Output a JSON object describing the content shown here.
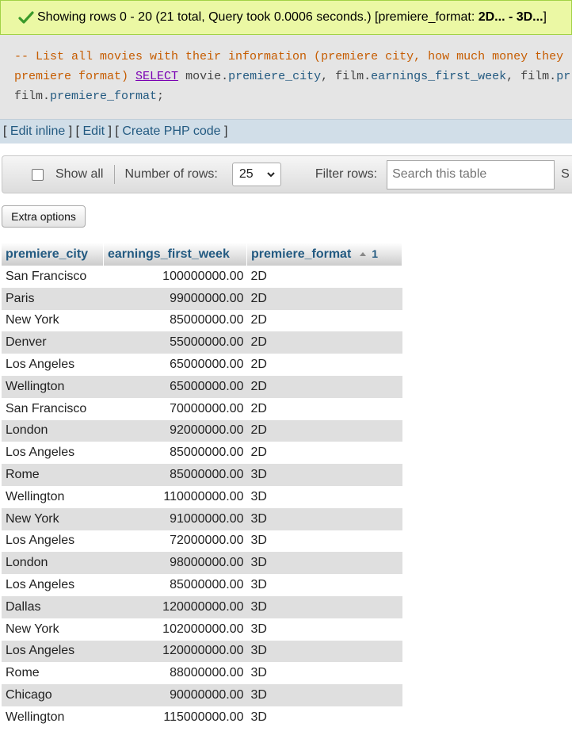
{
  "status": {
    "message": "Showing rows 0 - 20 (21 total, Query took 0.0006 seconds.) [premiere_format: ",
    "range": "2D... - 3D...",
    "close": "]"
  },
  "sql": {
    "comment_line1": "-- List all movies with their information (premiere city, how much money they",
    "comment_line2": "premiere format)",
    "keyword": "SELECT",
    "t1": "movie.",
    "col1": "premiere_city",
    "sep1": ", film.",
    "col2": "earnings_first_week",
    "sep2": ", film.",
    "col3_partial": "pr",
    "line3_prefix": "film.",
    "col3": "premiere_format",
    "end": ";"
  },
  "sql_links": {
    "edit_inline": "Edit inline",
    "edit": "Edit",
    "create_php": "Create PHP code"
  },
  "navigation": {
    "show_all_label": "Show all",
    "show_all_checked": false,
    "number_of_rows_label": "Number of rows:",
    "number_of_rows_value": "25",
    "filter_rows_label": "Filter rows:",
    "search_placeholder": "Search this table",
    "trailing_text": "S"
  },
  "extra_options_label": "Extra options",
  "table": {
    "columns": [
      "premiere_city",
      "earnings_first_week",
      "premiere_format"
    ],
    "sort_index": "1",
    "rows": [
      [
        "San Francisco",
        "100000000.00",
        "2D"
      ],
      [
        "Paris",
        "99000000.00",
        "2D"
      ],
      [
        "New York",
        "85000000.00",
        "2D"
      ],
      [
        "Denver",
        "55000000.00",
        "2D"
      ],
      [
        "Los Angeles",
        "65000000.00",
        "2D"
      ],
      [
        "Wellington",
        "65000000.00",
        "2D"
      ],
      [
        "San Francisco",
        "70000000.00",
        "2D"
      ],
      [
        "London",
        "92000000.00",
        "2D"
      ],
      [
        "Los Angeles",
        "85000000.00",
        "2D"
      ],
      [
        "Rome",
        "85000000.00",
        "3D"
      ],
      [
        "Wellington",
        "110000000.00",
        "3D"
      ],
      [
        "New York",
        "91000000.00",
        "3D"
      ],
      [
        "Los Angeles",
        "72000000.00",
        "3D"
      ],
      [
        "London",
        "98000000.00",
        "3D"
      ],
      [
        "Los Angeles",
        "85000000.00",
        "3D"
      ],
      [
        "Dallas",
        "120000000.00",
        "3D"
      ],
      [
        "New York",
        "102000000.00",
        "3D"
      ],
      [
        "Los Angeles",
        "120000000.00",
        "3D"
      ],
      [
        "Rome",
        "88000000.00",
        "3D"
      ],
      [
        "Chicago",
        "90000000.00",
        "3D"
      ],
      [
        "Wellington",
        "115000000.00",
        "3D"
      ]
    ]
  },
  "colors": {
    "status_bg": "#ebf8a4",
    "link": "#235a81",
    "comment": "#c65c00",
    "keyword": "#7a00b3"
  }
}
